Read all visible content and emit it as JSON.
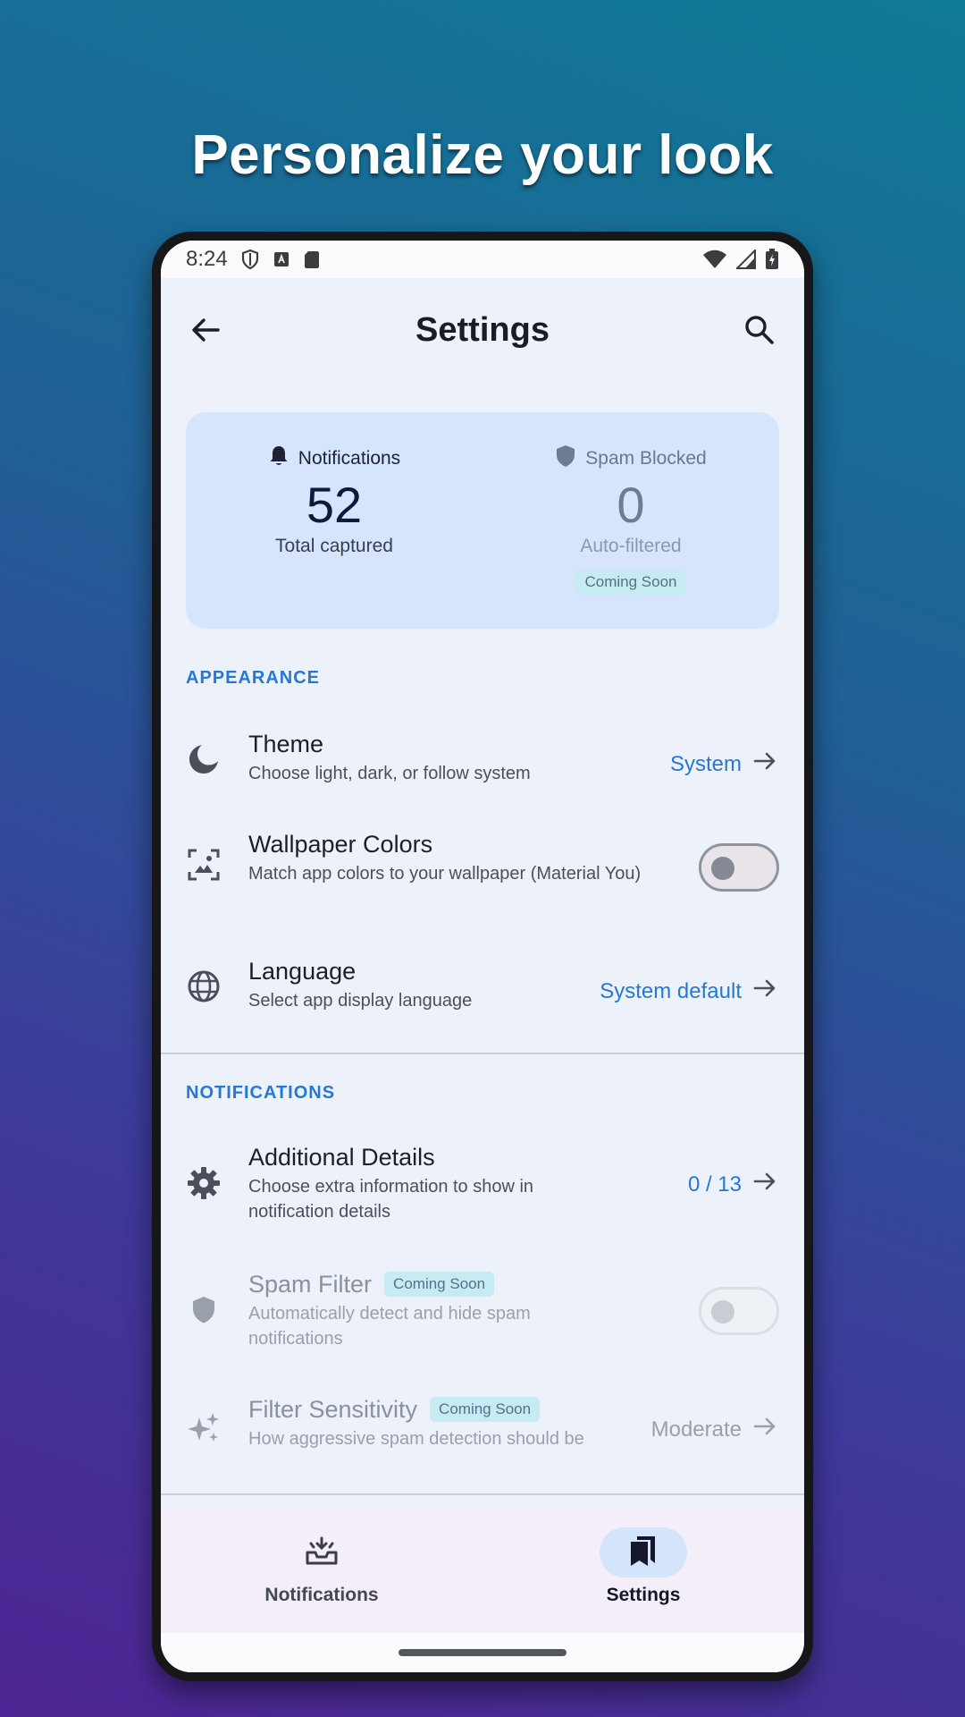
{
  "promo": {
    "title": "Personalize your look"
  },
  "status_bar": {
    "time": "8:24"
  },
  "app_bar": {
    "title": "Settings"
  },
  "stats": {
    "notifications": {
      "label": "Notifications",
      "value": "52",
      "sub": "Total captured"
    },
    "spam": {
      "label": "Spam Blocked",
      "value": "0",
      "sub": "Auto-filtered",
      "badge": "Coming Soon"
    }
  },
  "appearance": {
    "header": "APPEARANCE",
    "theme": {
      "title": "Theme",
      "subtitle": "Choose light, dark, or follow system",
      "value": "System"
    },
    "wallpaper": {
      "title": "Wallpaper Colors",
      "subtitle": "Match app colors to your wallpaper (Material You)",
      "enabled": false
    },
    "language": {
      "title": "Language",
      "subtitle": "Select app display language",
      "value": "System default"
    }
  },
  "notifications_section": {
    "header": "NOTIFICATIONS",
    "details": {
      "title": "Additional Details",
      "subtitle": "Choose extra information to show in notification details",
      "value": "0 / 13"
    },
    "spam_filter": {
      "title": "Spam Filter",
      "badge": "Coming Soon",
      "subtitle": "Automatically detect and hide spam notifications",
      "enabled": false
    },
    "sensitivity": {
      "title": "Filter Sensitivity",
      "badge": "Coming Soon",
      "subtitle": "How aggressive spam detection should be",
      "value": "Moderate"
    }
  },
  "bottom_nav": {
    "items": [
      {
        "label": "Notifications",
        "selected": false
      },
      {
        "label": "Settings",
        "selected": true
      }
    ]
  },
  "colors": {
    "accent": "#2578d3",
    "card": "#d6e5fc",
    "background": "#edf2fa",
    "chip": "#c6ebf3"
  }
}
